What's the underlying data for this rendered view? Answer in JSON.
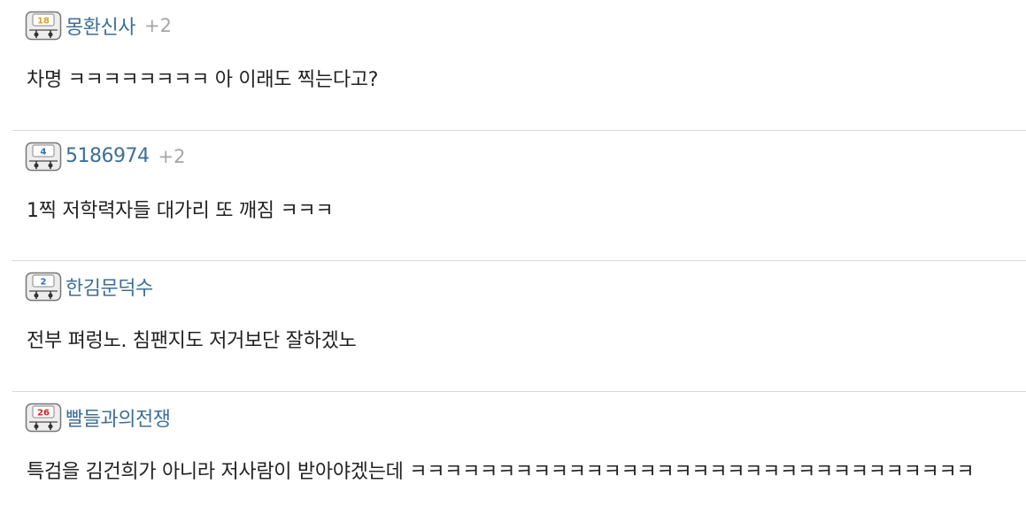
{
  "comments": [
    {
      "level": "18",
      "level_color": "#e0a020",
      "nickname": "몽환신사",
      "likes": "+2",
      "text": "차명 ㅋㅋㅋㅋㅋㅋㅋㅋ 아 이래도 찍는다고?"
    },
    {
      "level": "4",
      "level_color": "#2d6fb0",
      "nickname": "5186974",
      "likes": "+2",
      "text": "1찍 저학력자들 대가리 또 깨짐 ㅋㅋㅋ"
    },
    {
      "level": "2",
      "level_color": "#2d6fb0",
      "nickname": "한김문덕수",
      "likes": "",
      "text": "전부 펴렁노. 침팬지도 저거보단 잘하겠노"
    },
    {
      "level": "26",
      "level_color": "#d42020",
      "nickname": "빨들과의전쟁",
      "likes": "",
      "text": "특검을 김건희가 아니라 저사람이 받아야겠는데 ㅋㅋㅋㅋㅋㅋㅋㅋㅋㅋㅋㅋㅋㅋㅋㅋㅋㅋㅋㅋㅋㅋㅋㅋㅋㅋㅋㅋㅋㅋㅋㅋ"
    }
  ]
}
